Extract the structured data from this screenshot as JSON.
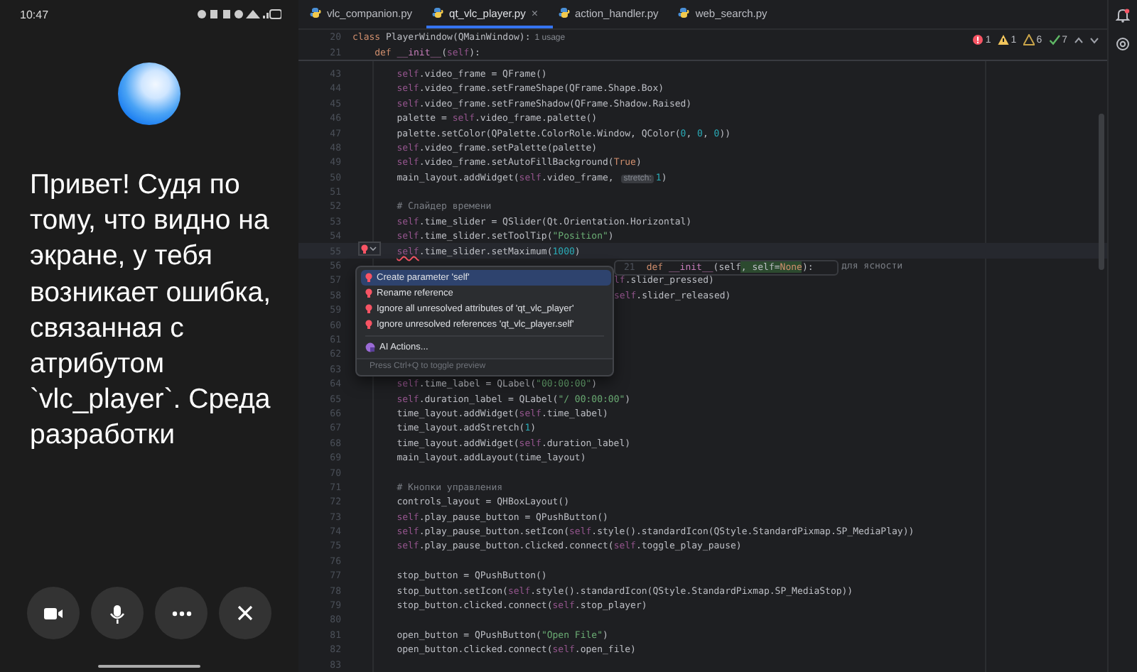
{
  "status_bar": {
    "time": "10:47"
  },
  "assistant": {
    "message": "Привет! Судя по тому, что видно на экране, у тебя возникает ошибка, связанная с атрибутом `vlc_player`. Среда разработки",
    "buttons": [
      {
        "kind": "camera"
      },
      {
        "kind": "mic"
      },
      {
        "kind": "more"
      },
      {
        "kind": "close"
      }
    ]
  },
  "editor": {
    "tabs": [
      {
        "label": "vlc_companion.py",
        "selected": false
      },
      {
        "label": "qt_vlc_player.py",
        "selected": true,
        "close": "×"
      },
      {
        "label": "action_handler.py",
        "selected": false
      },
      {
        "label": "web_search.py",
        "selected": false
      }
    ],
    "inspections": [
      {
        "kind": "error",
        "count": "1"
      },
      {
        "kind": "warning",
        "count": "1"
      },
      {
        "kind": "weak",
        "count": "6"
      },
      {
        "kind": "ok",
        "count": "7"
      }
    ],
    "sticky_lines": [
      {
        "num": "20",
        "kind": "class",
        "tokens": [
          {
            "kind": "kw",
            "text": "class "
          },
          {
            "kind": "plain",
            "text": "PlayerWindow(QMainWindow):"
          },
          {
            "kind": "hint",
            "text": "1 usage"
          }
        ]
      },
      {
        "num": "21",
        "kind": "method",
        "tokens": [
          {
            "kind": "kw",
            "text": "def "
          },
          {
            "kind": "fn",
            "text": "__init__"
          },
          {
            "kind": "plain",
            "text": "("
          },
          {
            "kind": "self",
            "text": "self"
          },
          {
            "kind": "plain",
            "text": "):"
          }
        ]
      }
    ],
    "lines": [
      {
        "num": "43",
        "kind": "statement",
        "tokens": [
          {
            "kind": "self",
            "text": "self"
          },
          {
            "kind": "plain",
            "text": ".video_frame = QFrame()"
          }
        ]
      },
      {
        "num": "44",
        "kind": "statement",
        "tokens": [
          {
            "kind": "self",
            "text": "self"
          },
          {
            "kind": "plain",
            "text": ".video_frame.setFrameShape(QFrame.Shape.Box)"
          }
        ]
      },
      {
        "num": "45",
        "kind": "statement",
        "tokens": [
          {
            "kind": "self",
            "text": "self"
          },
          {
            "kind": "plain",
            "text": ".video_frame.setFrameShadow(QFrame.Shadow.Raised)"
          }
        ]
      },
      {
        "num": "46",
        "kind": "statement",
        "tokens": [
          {
            "kind": "plain",
            "text": "palette = "
          },
          {
            "kind": "self",
            "text": "self"
          },
          {
            "kind": "plain",
            "text": ".video_frame.palette()"
          }
        ]
      },
      {
        "num": "47",
        "kind": "statement",
        "tokens": [
          {
            "kind": "plain",
            "text": "palette.setColor(QPalette.ColorRole.Window, QColor("
          },
          {
            "kind": "num",
            "text": "0"
          },
          {
            "kind": "plain",
            "text": ", "
          },
          {
            "kind": "num",
            "text": "0"
          },
          {
            "kind": "plain",
            "text": ", "
          },
          {
            "kind": "num",
            "text": "0"
          },
          {
            "kind": "plain",
            "text": "))"
          }
        ]
      },
      {
        "num": "48",
        "kind": "statement",
        "tokens": [
          {
            "kind": "self",
            "text": "self"
          },
          {
            "kind": "plain",
            "text": ".video_frame.setPalette(palette)"
          }
        ]
      },
      {
        "num": "49",
        "kind": "statement",
        "tokens": [
          {
            "kind": "self",
            "text": "self"
          },
          {
            "kind": "plain",
            "text": ".video_frame.setAutoFillBackground("
          },
          {
            "kind": "kw",
            "text": "True"
          },
          {
            "kind": "plain",
            "text": ")"
          }
        ]
      },
      {
        "num": "50",
        "kind": "statement",
        "tokens": [
          {
            "kind": "plain",
            "text": "main_layout.addWidget("
          },
          {
            "kind": "self",
            "text": "self"
          },
          {
            "kind": "plain",
            "text": ".video_frame, "
          },
          {
            "kind": "hint",
            "text": "stretch:"
          },
          {
            "kind": "num",
            "text": "1"
          },
          {
            "kind": "plain",
            "text": ")"
          }
        ]
      },
      {
        "num": "51",
        "kind": "blank"
      },
      {
        "num": "52",
        "kind": "statement",
        "tokens": [
          {
            "kind": "cmt",
            "text": "# Слайдер времени"
          }
        ]
      },
      {
        "num": "53",
        "kind": "statement",
        "tokens": [
          {
            "kind": "self",
            "text": "self"
          },
          {
            "kind": "plain",
            "text": ".time_slider = QSlider(Qt.Orientation.Horizontal)"
          }
        ]
      },
      {
        "num": "54",
        "kind": "statement",
        "tokens": [
          {
            "kind": "self",
            "text": "self"
          },
          {
            "kind": "plain",
            "text": ".time_slider.setToolTip("
          },
          {
            "kind": "str",
            "text": "\"Position\""
          },
          {
            "kind": "plain",
            "text": ")"
          }
        ]
      },
      {
        "num": "55",
        "kind": "current",
        "tokens": [
          {
            "kind": "err",
            "text": "self"
          },
          {
            "kind": "plain",
            "text": ".time_slider.setMaximum("
          },
          {
            "kind": "num",
            "text": "1000"
          },
          {
            "kind": "plain",
            "text": ")"
          }
        ]
      },
      {
        "num": "56",
        "kind": "behind_preview",
        "tokens": [
          {
            "kind": "cmt",
            "text": "для ясности"
          }
        ]
      },
      {
        "num": "57",
        "kind": "behind_popup",
        "tokens": [
          {
            "kind": "self",
            "text": "lf"
          },
          {
            "kind": "plain",
            "text": ".slider_pressed)"
          }
        ]
      },
      {
        "num": "58",
        "kind": "behind_popup",
        "tokens": [
          {
            "kind": "self",
            "text": "self"
          },
          {
            "kind": "plain",
            "text": ".slider_released)"
          }
        ]
      },
      {
        "num": "59",
        "kind": "blank"
      },
      {
        "num": "60",
        "kind": "blank"
      },
      {
        "num": "61",
        "kind": "blank"
      },
      {
        "num": "62",
        "kind": "blank"
      },
      {
        "num": "63",
        "kind": "blank"
      },
      {
        "num": "64",
        "kind": "statement",
        "tokens": [
          {
            "kind": "self",
            "text": "self"
          },
          {
            "kind": "plain",
            "text": ".time_label = QLabel("
          },
          {
            "kind": "str",
            "text": "\"00:00:00\""
          },
          {
            "kind": "plain",
            "text": ")"
          }
        ]
      },
      {
        "num": "65",
        "kind": "statement",
        "tokens": [
          {
            "kind": "self",
            "text": "self"
          },
          {
            "kind": "plain",
            "text": ".duration_label = QLabel("
          },
          {
            "kind": "str",
            "text": "\"/ 00:00:00\""
          },
          {
            "kind": "plain",
            "text": ")"
          }
        ]
      },
      {
        "num": "66",
        "kind": "statement",
        "tokens": [
          {
            "kind": "plain",
            "text": "time_layout.addWidget("
          },
          {
            "kind": "self",
            "text": "self"
          },
          {
            "kind": "plain",
            "text": ".time_label)"
          }
        ]
      },
      {
        "num": "67",
        "kind": "statement",
        "tokens": [
          {
            "kind": "plain",
            "text": "time_layout.addStretch("
          },
          {
            "kind": "num",
            "text": "1"
          },
          {
            "kind": "plain",
            "text": ")"
          }
        ]
      },
      {
        "num": "68",
        "kind": "statement",
        "tokens": [
          {
            "kind": "plain",
            "text": "time_layout.addWidget("
          },
          {
            "kind": "self",
            "text": "self"
          },
          {
            "kind": "plain",
            "text": ".duration_label)"
          }
        ]
      },
      {
        "num": "69",
        "kind": "statement",
        "tokens": [
          {
            "kind": "plain",
            "text": "main_layout.addLayout(time_layout)"
          }
        ]
      },
      {
        "num": "70",
        "kind": "blank"
      },
      {
        "num": "71",
        "kind": "statement",
        "tokens": [
          {
            "kind": "cmt",
            "text": "# Кнопки управления"
          }
        ]
      },
      {
        "num": "72",
        "kind": "statement",
        "tokens": [
          {
            "kind": "plain",
            "text": "controls_layout = QHBoxLayout()"
          }
        ]
      },
      {
        "num": "73",
        "kind": "statement",
        "tokens": [
          {
            "kind": "self",
            "text": "self"
          },
          {
            "kind": "plain",
            "text": ".play_pause_button = QPushButton()"
          }
        ]
      },
      {
        "num": "74",
        "kind": "statement",
        "tokens": [
          {
            "kind": "self",
            "text": "self"
          },
          {
            "kind": "plain",
            "text": ".play_pause_button.setIcon("
          },
          {
            "kind": "self",
            "text": "self"
          },
          {
            "kind": "plain",
            "text": ".style().standardIcon(QStyle.StandardPixmap.SP_MediaPlay))"
          }
        ]
      },
      {
        "num": "75",
        "kind": "statement",
        "tokens": [
          {
            "kind": "self",
            "text": "self"
          },
          {
            "kind": "plain",
            "text": ".play_pause_button.clicked.connect("
          },
          {
            "kind": "self",
            "text": "self"
          },
          {
            "kind": "plain",
            "text": ".toggle_play_pause)"
          }
        ]
      },
      {
        "num": "76",
        "kind": "blank"
      },
      {
        "num": "77",
        "kind": "statement",
        "tokens": [
          {
            "kind": "plain",
            "text": "stop_button = QPushButton()"
          }
        ]
      },
      {
        "num": "78",
        "kind": "statement",
        "tokens": [
          {
            "kind": "plain",
            "text": "stop_button.setIcon("
          },
          {
            "kind": "self",
            "text": "self"
          },
          {
            "kind": "plain",
            "text": ".style().standardIcon(QStyle.StandardPixmap.SP_MediaStop))"
          }
        ]
      },
      {
        "num": "79",
        "kind": "statement",
        "tokens": [
          {
            "kind": "plain",
            "text": "stop_button.clicked.connect("
          },
          {
            "kind": "self",
            "text": "self"
          },
          {
            "kind": "plain",
            "text": ".stop_player)"
          }
        ]
      },
      {
        "num": "80",
        "kind": "blank"
      },
      {
        "num": "81",
        "kind": "statement",
        "tokens": [
          {
            "kind": "plain",
            "text": "open_button = QPushButton("
          },
          {
            "kind": "str",
            "text": "\"Open File\""
          },
          {
            "kind": "plain",
            "text": ")"
          }
        ]
      },
      {
        "num": "82",
        "kind": "statement",
        "tokens": [
          {
            "kind": "plain",
            "text": "open_button.clicked.connect("
          },
          {
            "kind": "self",
            "text": "self"
          },
          {
            "kind": "plain",
            "text": ".open_file)"
          }
        ]
      },
      {
        "num": "83",
        "kind": "blank"
      }
    ],
    "intention_menu": {
      "items": [
        {
          "kind": "bulb",
          "label": "Create parameter 'self'",
          "selected": true
        },
        {
          "kind": "bulb",
          "label": "Rename reference",
          "selected": false
        },
        {
          "kind": "bulb",
          "label": "Ignore all unresolved attributes of 'qt_vlc_player'",
          "selected": false
        },
        {
          "kind": "bulb",
          "label": "Ignore unresolved references 'qt_vlc_player.self'",
          "selected": false
        },
        {
          "kind": "ai",
          "label": "AI Actions...",
          "selected": false
        }
      ],
      "footer": "Press Ctrl+Q to toggle preview"
    },
    "preview": {
      "num": "21",
      "tokens": [
        {
          "kind": "kw",
          "text": "def "
        },
        {
          "kind": "fn",
          "text": "__init__"
        },
        {
          "kind": "plain",
          "text": "(self"
        },
        {
          "kind": "add",
          "text": ", self="
        },
        {
          "kind": "addkw",
          "text": "None"
        },
        {
          "kind": "plain",
          "text": "):"
        }
      ]
    }
  }
}
